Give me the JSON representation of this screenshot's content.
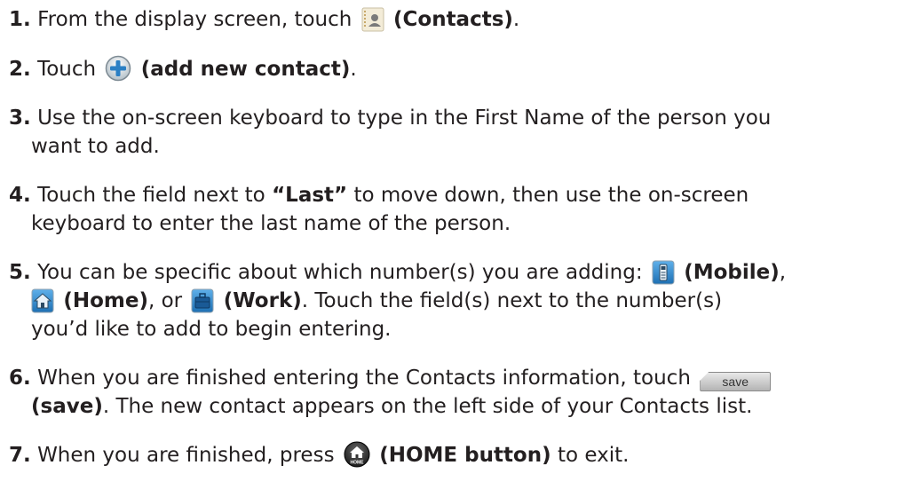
{
  "steps": [
    {
      "number": "1.",
      "line1_pre": "From the display screen, touch",
      "icon": "contacts-icon",
      "line1_bold": "(Contacts)",
      "line1_post": "."
    },
    {
      "number": "2.",
      "line1_pre": "Touch",
      "icon": "add-contact-icon",
      "line1_bold": "(add new contact)",
      "line1_post": "."
    },
    {
      "number": "3.",
      "line1": "Use the on-screen keyboard to type in the First Name of the person you",
      "line2": "want to add."
    },
    {
      "number": "4.",
      "line1_pre": "Touch the field next to",
      "line1_bold": "“Last”",
      "line1_post": "to move down, then use the on-screen",
      "line2": "keyboard to enter the last name of the person."
    },
    {
      "number": "5.",
      "line1_pre": "You can be specific about which number(s) you are adding:",
      "mobile_bold": "(Mobile)",
      "comma": ",",
      "home_bold": "(Home)",
      "or_text": ", or",
      "work_bold": "(Work)",
      "line2_post": ". Touch the field(s) next to the number(s)",
      "line3": "you’d like to add to begin entering."
    },
    {
      "number": "6.",
      "line1_pre": "When you are finished entering the Contacts information, touch",
      "save_button_label": "save",
      "line2_bold": "(save)",
      "line2_post": ". The new contact appears on the left side of your Contacts list."
    },
    {
      "number": "7.",
      "line1_pre": "When you are finished, press",
      "home_icon_label": "HOME",
      "line1_bold": "(HOME button)",
      "line1_post": "to exit."
    }
  ],
  "colors": {
    "text": "#231f20",
    "icon_blue": "#2a7fc4"
  }
}
